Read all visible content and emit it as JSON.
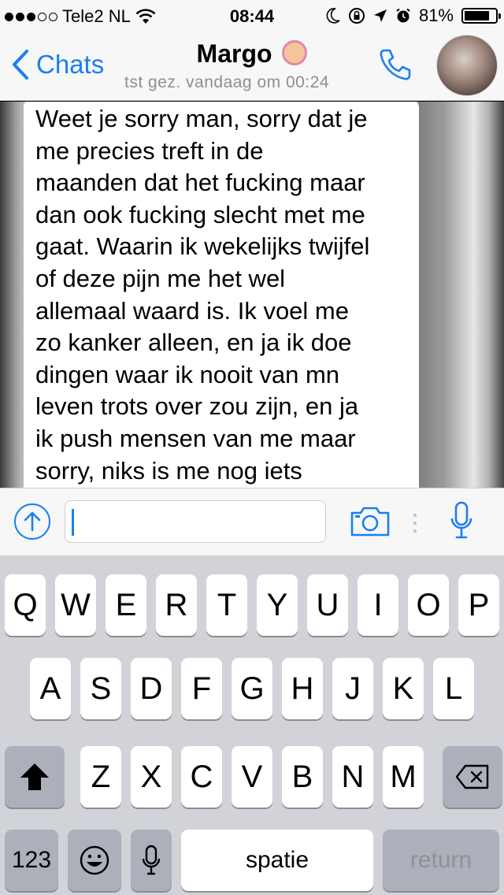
{
  "status_bar": {
    "carrier": "Tele2 NL",
    "time": "08:44",
    "battery": "81%",
    "battery_level": 0.81,
    "icons": [
      "signal-dots",
      "wifi-icon",
      "moon-icon",
      "rotation-lock-icon",
      "location-icon",
      "alarm-icon",
      "battery-icon"
    ]
  },
  "nav": {
    "back_label": "Chats",
    "title": "Margo",
    "subtitle": "tst gez. vandaag om 00:24",
    "title_emoji": "woman-gesturing-emoji"
  },
  "chat": {
    "messages": [
      {
        "lines": [
          "Weet je sorry man, sorry dat je",
          "me precies treft in de",
          "maanden dat het fucking maar",
          "dan ook fucking slecht met me",
          "gaat. Waarin ik wekelijks twijfel",
          "of deze pijn me het wel",
          "allemaal waard is. Ik voel me",
          "zo kanker alleen, en ja ik doe",
          "dingen waar ik nooit van mn",
          "leven trots over zou zijn, en ja",
          "ik push mensen van me maar",
          "sorry, niks is me nog iets"
        ]
      }
    ]
  },
  "input": {
    "value": ""
  },
  "keyboard": {
    "row1": [
      "Q",
      "W",
      "E",
      "R",
      "T",
      "Y",
      "U",
      "I",
      "O",
      "P"
    ],
    "row2": [
      "A",
      "S",
      "D",
      "F",
      "G",
      "H",
      "J",
      "K",
      "L"
    ],
    "row3": [
      "Z",
      "X",
      "C",
      "V",
      "B",
      "N",
      "M"
    ],
    "numbers_label": "123",
    "space_label": "spatie",
    "return_label": "return"
  },
  "colors": {
    "accent": "#1a7ff0",
    "bar_bg": "#f7f7f7",
    "keyboard_bg": "#d1d3d9",
    "bubble_bg": "#ffffff"
  }
}
